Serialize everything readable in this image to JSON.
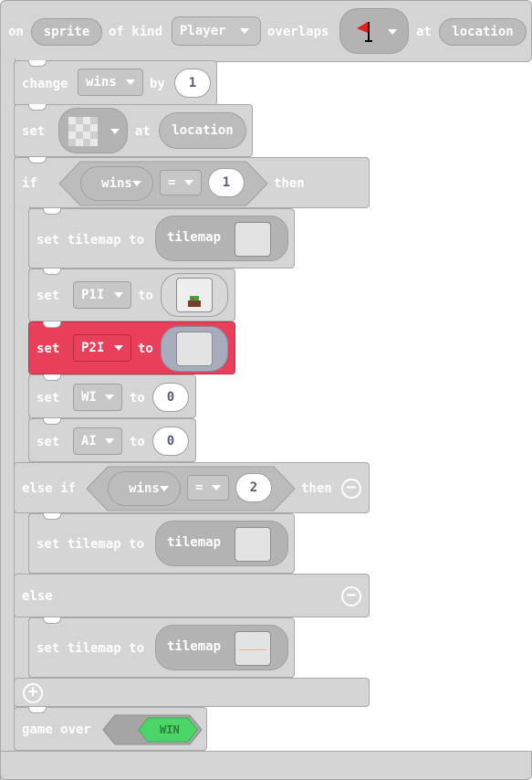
{
  "event": {
    "on": "on",
    "sprite": "sprite",
    "of_kind": "of kind",
    "kind_value": "Player",
    "overlaps": "overlaps",
    "at": "at",
    "location": "location"
  },
  "change": {
    "label": "change",
    "var": "wins",
    "by": "by",
    "value": "1"
  },
  "set_tile": {
    "label": "set",
    "at": "at",
    "location": "location"
  },
  "if_block": {
    "if": "if",
    "var": "wins",
    "op": "=",
    "value": "1",
    "then": "then"
  },
  "tilemap1": {
    "label": "set tilemap to",
    "value": "tilemap"
  },
  "p1i": {
    "label": "set",
    "var": "P1I",
    "to": "to"
  },
  "p2i": {
    "label": "set",
    "var": "P2I",
    "to": "to"
  },
  "wi": {
    "label": "set",
    "var": "WI",
    "to": "to",
    "value": "0"
  },
  "ai": {
    "label": "set",
    "var": "AI",
    "to": "to",
    "value": "0"
  },
  "elseif": {
    "label": "else if",
    "var": "wins",
    "op": "=",
    "value": "2",
    "then": "then"
  },
  "tilemap2": {
    "label": "set tilemap to",
    "value": "tilemap"
  },
  "else_block": {
    "label": "else"
  },
  "tilemap3": {
    "label": "set tilemap to",
    "value": "tilemap"
  },
  "gameover": {
    "label": "game over",
    "result": "WIN"
  },
  "colors": {
    "block": "#d5d5d5",
    "selected": "#e8405b",
    "win": "#4bd567"
  }
}
